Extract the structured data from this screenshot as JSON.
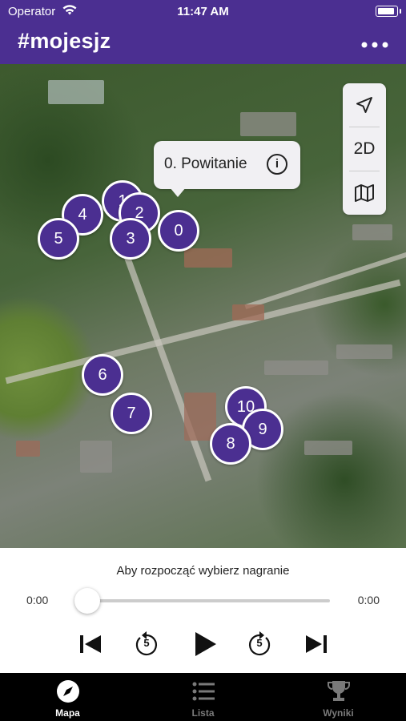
{
  "status_bar": {
    "carrier": "Operator",
    "time": "11:47 AM"
  },
  "app_bar": {
    "title": "#mojesjz",
    "menu_icon": "more-horizontal-icon"
  },
  "map": {
    "callout": {
      "label": "0. Powitanie",
      "info_icon": "info-circle-icon"
    },
    "controls": {
      "locate_icon": "location-arrow-icon",
      "view_toggle_label": "2D",
      "map_type_icon": "map-icon"
    },
    "markers": [
      "0",
      "1",
      "2",
      "3",
      "4",
      "5",
      "6",
      "7",
      "8",
      "9",
      "10"
    ]
  },
  "player": {
    "prompt": "Aby rozpocząć wybierz nagranie",
    "current_time": "0:00",
    "total_time": "0:00",
    "progress": 0,
    "controls": {
      "previous": "skip-back-icon",
      "rewind_label": "5",
      "play": "play-icon",
      "forward_label": "5",
      "next": "skip-forward-icon"
    }
  },
  "tabs": [
    {
      "label": "Mapa",
      "icon": "compass-icon",
      "active": true
    },
    {
      "label": "Lista",
      "icon": "list-icon",
      "active": false
    },
    {
      "label": "Wyniki",
      "icon": "trophy-icon",
      "active": false
    }
  ],
  "colors": {
    "brand": "#4b2f91",
    "tab_active": "#ffffff",
    "tab_inactive": "#7a7a7a"
  }
}
